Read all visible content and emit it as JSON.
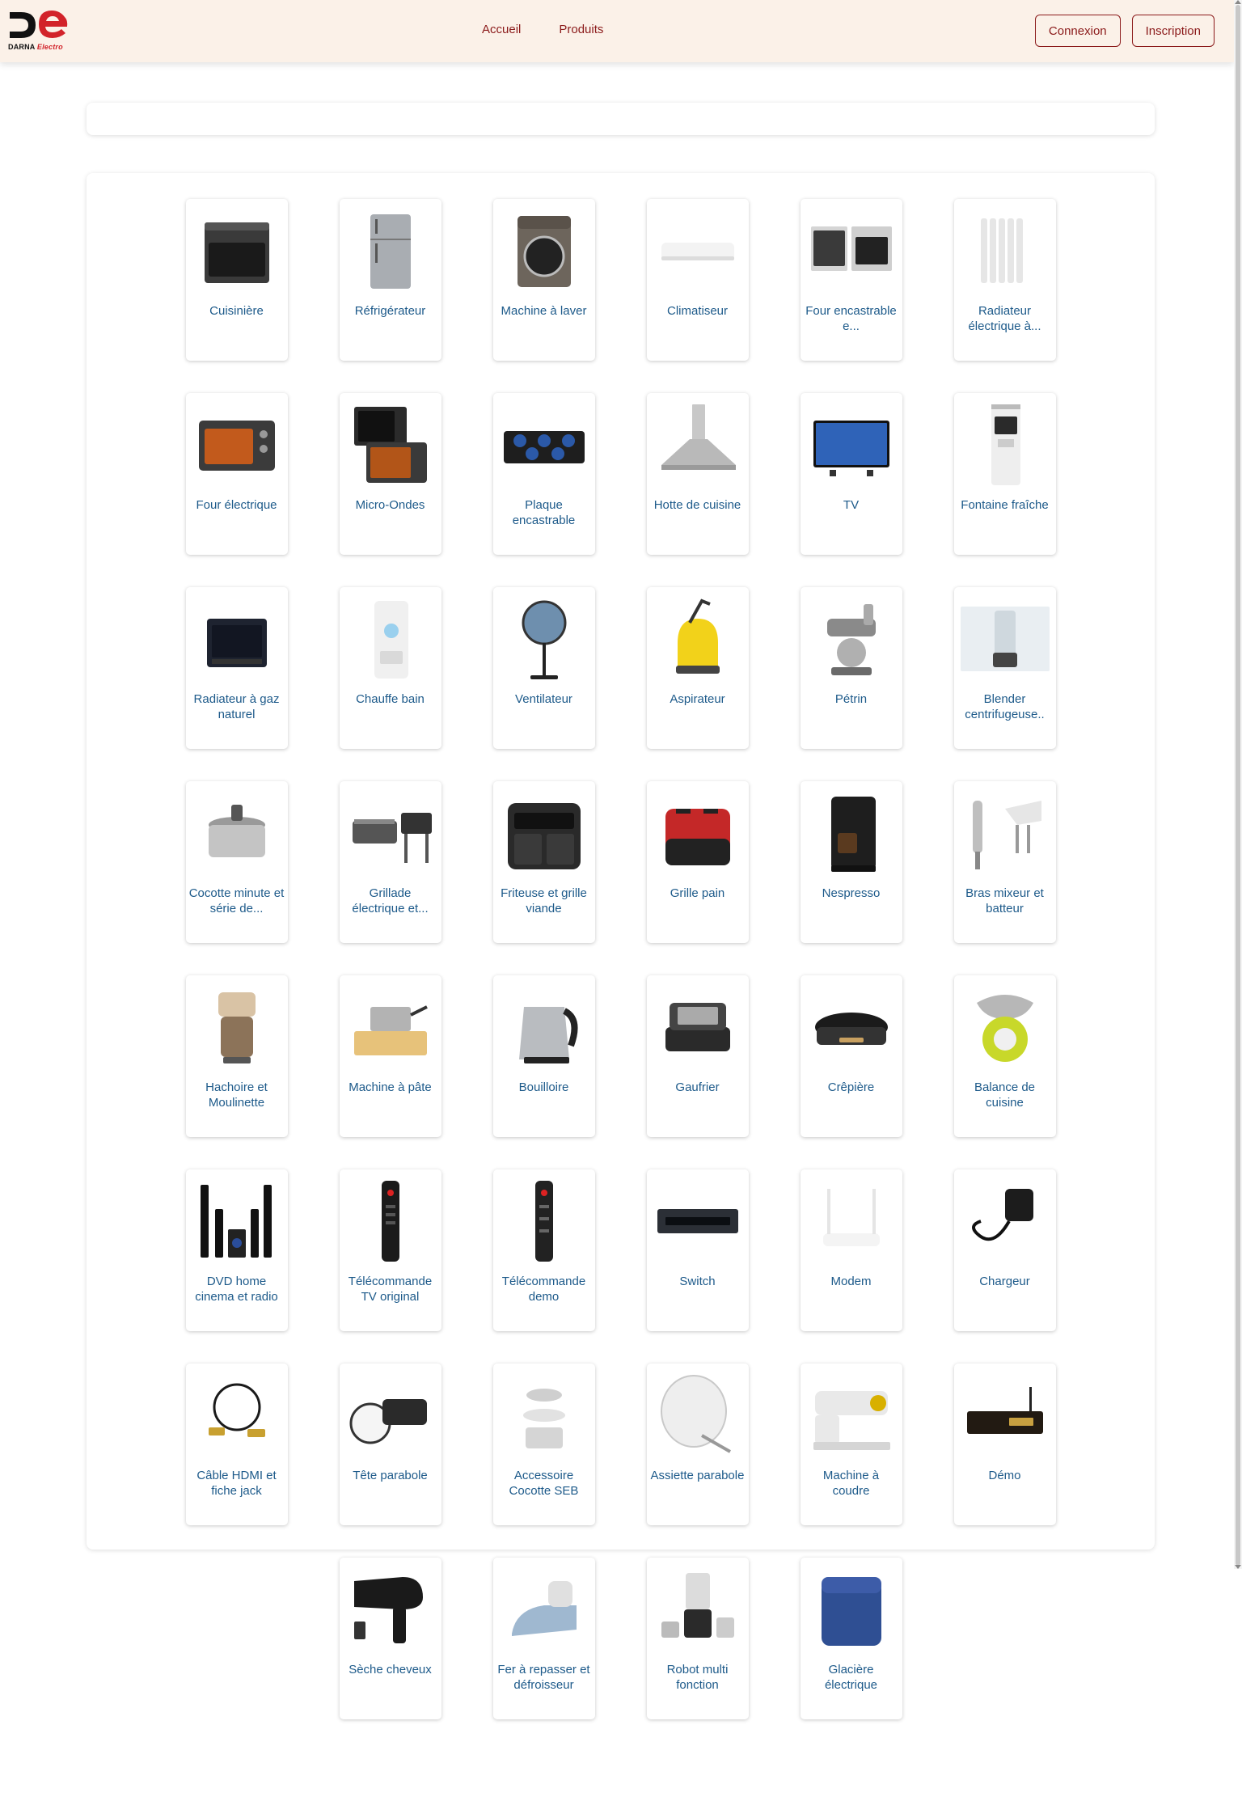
{
  "header": {
    "logo_text_main": "DARNA ",
    "logo_text_accent": "Electro",
    "nav": [
      {
        "label": "Accueil"
      },
      {
        "label": "Produits"
      }
    ],
    "login_label": "Connexion",
    "signup_label": "Inscription"
  },
  "colors": {
    "header_bg": "#fbf1e8",
    "brand_red": "#d2232a",
    "nav_text": "#8b1a1a",
    "tile_label": "#1d5a8a"
  },
  "categories": [
    {
      "label": "Cuisinière",
      "icon": "stove-icon"
    },
    {
      "label": "Réfrigérateur",
      "icon": "fridge-icon"
    },
    {
      "label": "Machine à laver",
      "icon": "washing-machine-icon"
    },
    {
      "label": "Climatiseur",
      "icon": "air-conditioner-icon"
    },
    {
      "label": "Four encastrable e...",
      "icon": "built-in-oven-icon"
    },
    {
      "label": "Radiateur électrique à...",
      "icon": "electric-radiator-icon"
    },
    {
      "label": "Four électrique",
      "icon": "electric-oven-icon"
    },
    {
      "label": "Micro-Ondes",
      "icon": "microwave-icon"
    },
    {
      "label": "Plaque encastrable",
      "icon": "gas-hob-icon"
    },
    {
      "label": "Hotte de cuisine",
      "icon": "range-hood-icon"
    },
    {
      "label": "TV",
      "icon": "tv-icon"
    },
    {
      "label": "Fontaine fraîche",
      "icon": "water-dispenser-icon"
    },
    {
      "label": "Radiateur à gaz naturel",
      "icon": "gas-heater-icon"
    },
    {
      "label": "Chauffe bain",
      "icon": "water-heater-icon"
    },
    {
      "label": "Ventilateur",
      "icon": "fan-icon"
    },
    {
      "label": "Aspirateur",
      "icon": "vacuum-icon"
    },
    {
      "label": "Pétrin",
      "icon": "stand-mixer-icon"
    },
    {
      "label": "Blender centrifugeuse..",
      "icon": "blender-icon"
    },
    {
      "label": "Cocotte minute et série de...",
      "icon": "pressure-cooker-icon"
    },
    {
      "label": "Grillade électrique et...",
      "icon": "electric-grill-icon"
    },
    {
      "label": "Friteuse et grille viande",
      "icon": "air-fryer-icon"
    },
    {
      "label": "Grille pain",
      "icon": "toaster-icon"
    },
    {
      "label": "Nespresso",
      "icon": "coffee-machine-icon"
    },
    {
      "label": "Bras mixeur et batteur",
      "icon": "hand-mixer-icon"
    },
    {
      "label": "Hachoire et Moulinette",
      "icon": "grinder-icon"
    },
    {
      "label": "Machine à pâte",
      "icon": "pasta-machine-icon"
    },
    {
      "label": "Bouilloire",
      "icon": "kettle-icon"
    },
    {
      "label": "Gaufrier",
      "icon": "waffle-maker-icon"
    },
    {
      "label": "Crêpière",
      "icon": "crepe-maker-icon"
    },
    {
      "label": "Balance de cuisine",
      "icon": "kitchen-scale-icon"
    },
    {
      "label": "DVD home cinema et radio",
      "icon": "home-cinema-icon"
    },
    {
      "label": "Télécommande TV original",
      "icon": "remote-icon"
    },
    {
      "label": "Télécommande demo",
      "icon": "remote-demo-icon"
    },
    {
      "label": "Switch",
      "icon": "network-switch-icon"
    },
    {
      "label": "Modem",
      "icon": "modem-icon"
    },
    {
      "label": "Chargeur",
      "icon": "charger-icon"
    },
    {
      "label": "Câble HDMI et fiche jack",
      "icon": "cable-icon"
    },
    {
      "label": "Tête parabole",
      "icon": "lnb-icon"
    },
    {
      "label": "Accessoire Cocotte SEB",
      "icon": "cooker-accessory-icon"
    },
    {
      "label": "Assiette parabole",
      "icon": "satellite-dish-icon"
    },
    {
      "label": "Machine à coudre",
      "icon": "sewing-machine-icon"
    },
    {
      "label": "Démo",
      "icon": "receiver-icon"
    },
    {
      "label": "Sèche cheveux",
      "icon": "hair-dryer-icon"
    },
    {
      "label": "Fer à repasser et défroisseur",
      "icon": "iron-icon"
    },
    {
      "label": "Robot multi fonction",
      "icon": "food-processor-icon"
    },
    {
      "label": "Glacière électrique",
      "icon": "cooler-icon"
    }
  ]
}
